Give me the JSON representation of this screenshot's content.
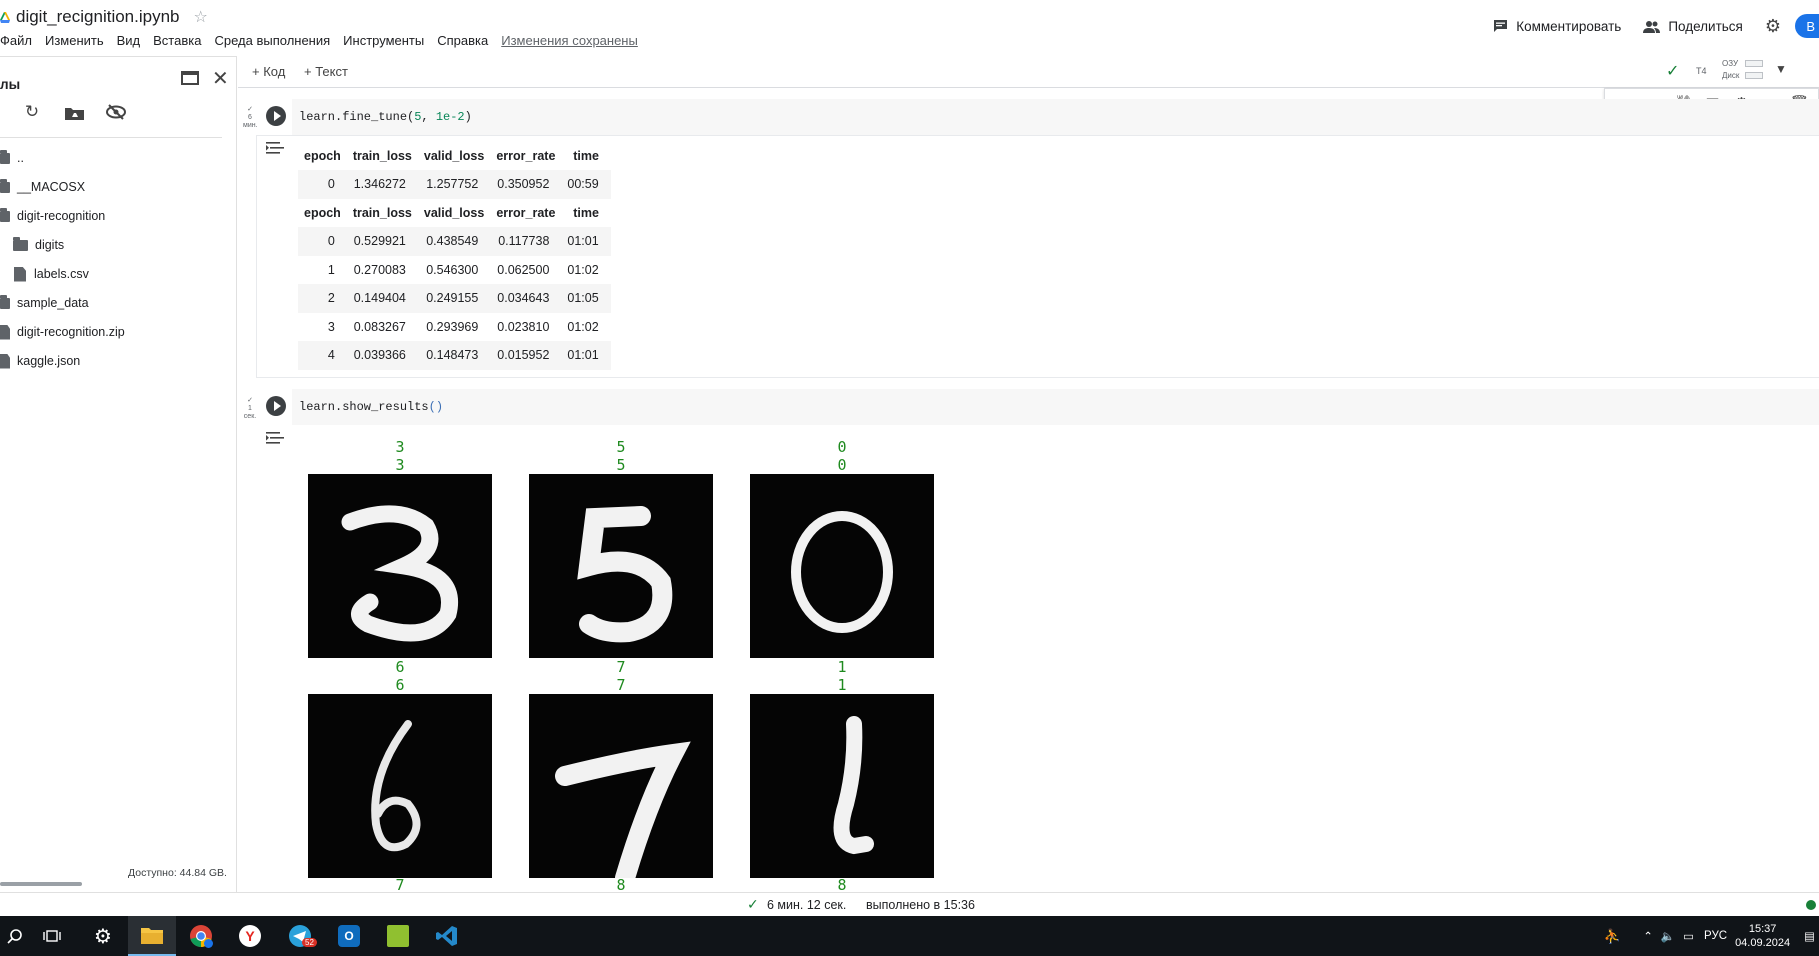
{
  "header": {
    "notebook_title": "digit_recignition.ipynb",
    "menu": [
      "Файл",
      "Изменить",
      "Вид",
      "Вставка",
      "Среда выполнения",
      "Инструменты",
      "Справка"
    ],
    "saved_status": "Изменения сохранены",
    "comment_label": "Комментировать",
    "share_label": "Поделиться",
    "avatar_letter": "В"
  },
  "sidebar": {
    "title": "лы",
    "files": [
      {
        "name": "..",
        "type": "folder"
      },
      {
        "name": "__MACOSX",
        "type": "folder"
      },
      {
        "name": "digit-recognition",
        "type": "folder"
      },
      {
        "name": "digits",
        "type": "folder"
      },
      {
        "name": "labels.csv",
        "type": "file"
      },
      {
        "name": "sample_data",
        "type": "folder"
      },
      {
        "name": "digit-recognition.zip",
        "type": "file"
      },
      {
        "name": "kaggle.json",
        "type": "file"
      }
    ],
    "disk_available": "Доступно: 44.84 GB."
  },
  "toolbar": {
    "add_code": "+ Код",
    "add_text": "+ Текст",
    "runtime_type": "T4",
    "ram_label": "ОЗУ",
    "disk_label": "Диск"
  },
  "cells": [
    {
      "status": "✓\n6\nмин.",
      "code_fn": "learn.fine_tune(",
      "code_arg1": "5",
      "code_sep": ", ",
      "code_arg2": "1e-2",
      "code_close": ")",
      "table_headers": [
        "epoch",
        "train_loss",
        "valid_loss",
        "error_rate",
        "time"
      ],
      "table_a": [
        [
          "0",
          "1.346272",
          "1.257752",
          "0.350952",
          "00:59"
        ]
      ],
      "table_b": [
        [
          "0",
          "0.529921",
          "0.438549",
          "0.117738",
          "01:01"
        ],
        [
          "1",
          "0.270083",
          "0.546300",
          "0.062500",
          "01:02"
        ],
        [
          "2",
          "0.149404",
          "0.249155",
          "0.034643",
          "01:05"
        ],
        [
          "3",
          "0.083267",
          "0.293969",
          "0.023810",
          "01:02"
        ],
        [
          "4",
          "0.039366",
          "0.148473",
          "0.015952",
          "01:01"
        ]
      ]
    },
    {
      "status": "✓\n1\nсек.",
      "code_fn": "learn.show_results",
      "code_parens": "()",
      "results": [
        {
          "actual": "3",
          "predicted": "3",
          "digit": "3"
        },
        {
          "actual": "5",
          "predicted": "5",
          "digit": "5"
        },
        {
          "actual": "0",
          "predicted": "0",
          "digit": "0"
        },
        {
          "actual": "6",
          "predicted": "6",
          "digit": "6"
        },
        {
          "actual": "7",
          "predicted": "7",
          "digit": "7"
        },
        {
          "actual": "1",
          "predicted": "1",
          "digit": "1"
        }
      ],
      "next_row_labels": [
        "7",
        "8",
        "8"
      ]
    }
  ],
  "status_bar": {
    "duration": "6 мин. 12 сек.",
    "finished": "выполнено в 15:36"
  },
  "taskbar": {
    "apps": [
      "search",
      "task-view",
      "settings",
      "file-explorer",
      "chrome",
      "yandex-browser",
      "telegram",
      "outlook",
      "notepad-plus",
      "vscode"
    ],
    "telegram_badge": "52",
    "language": "РУС",
    "time": "15:37",
    "date": "04.09.2024"
  },
  "colors": {
    "result_label": "#1f8a1f",
    "accent": "#1a73e8",
    "success": "#188038"
  }
}
